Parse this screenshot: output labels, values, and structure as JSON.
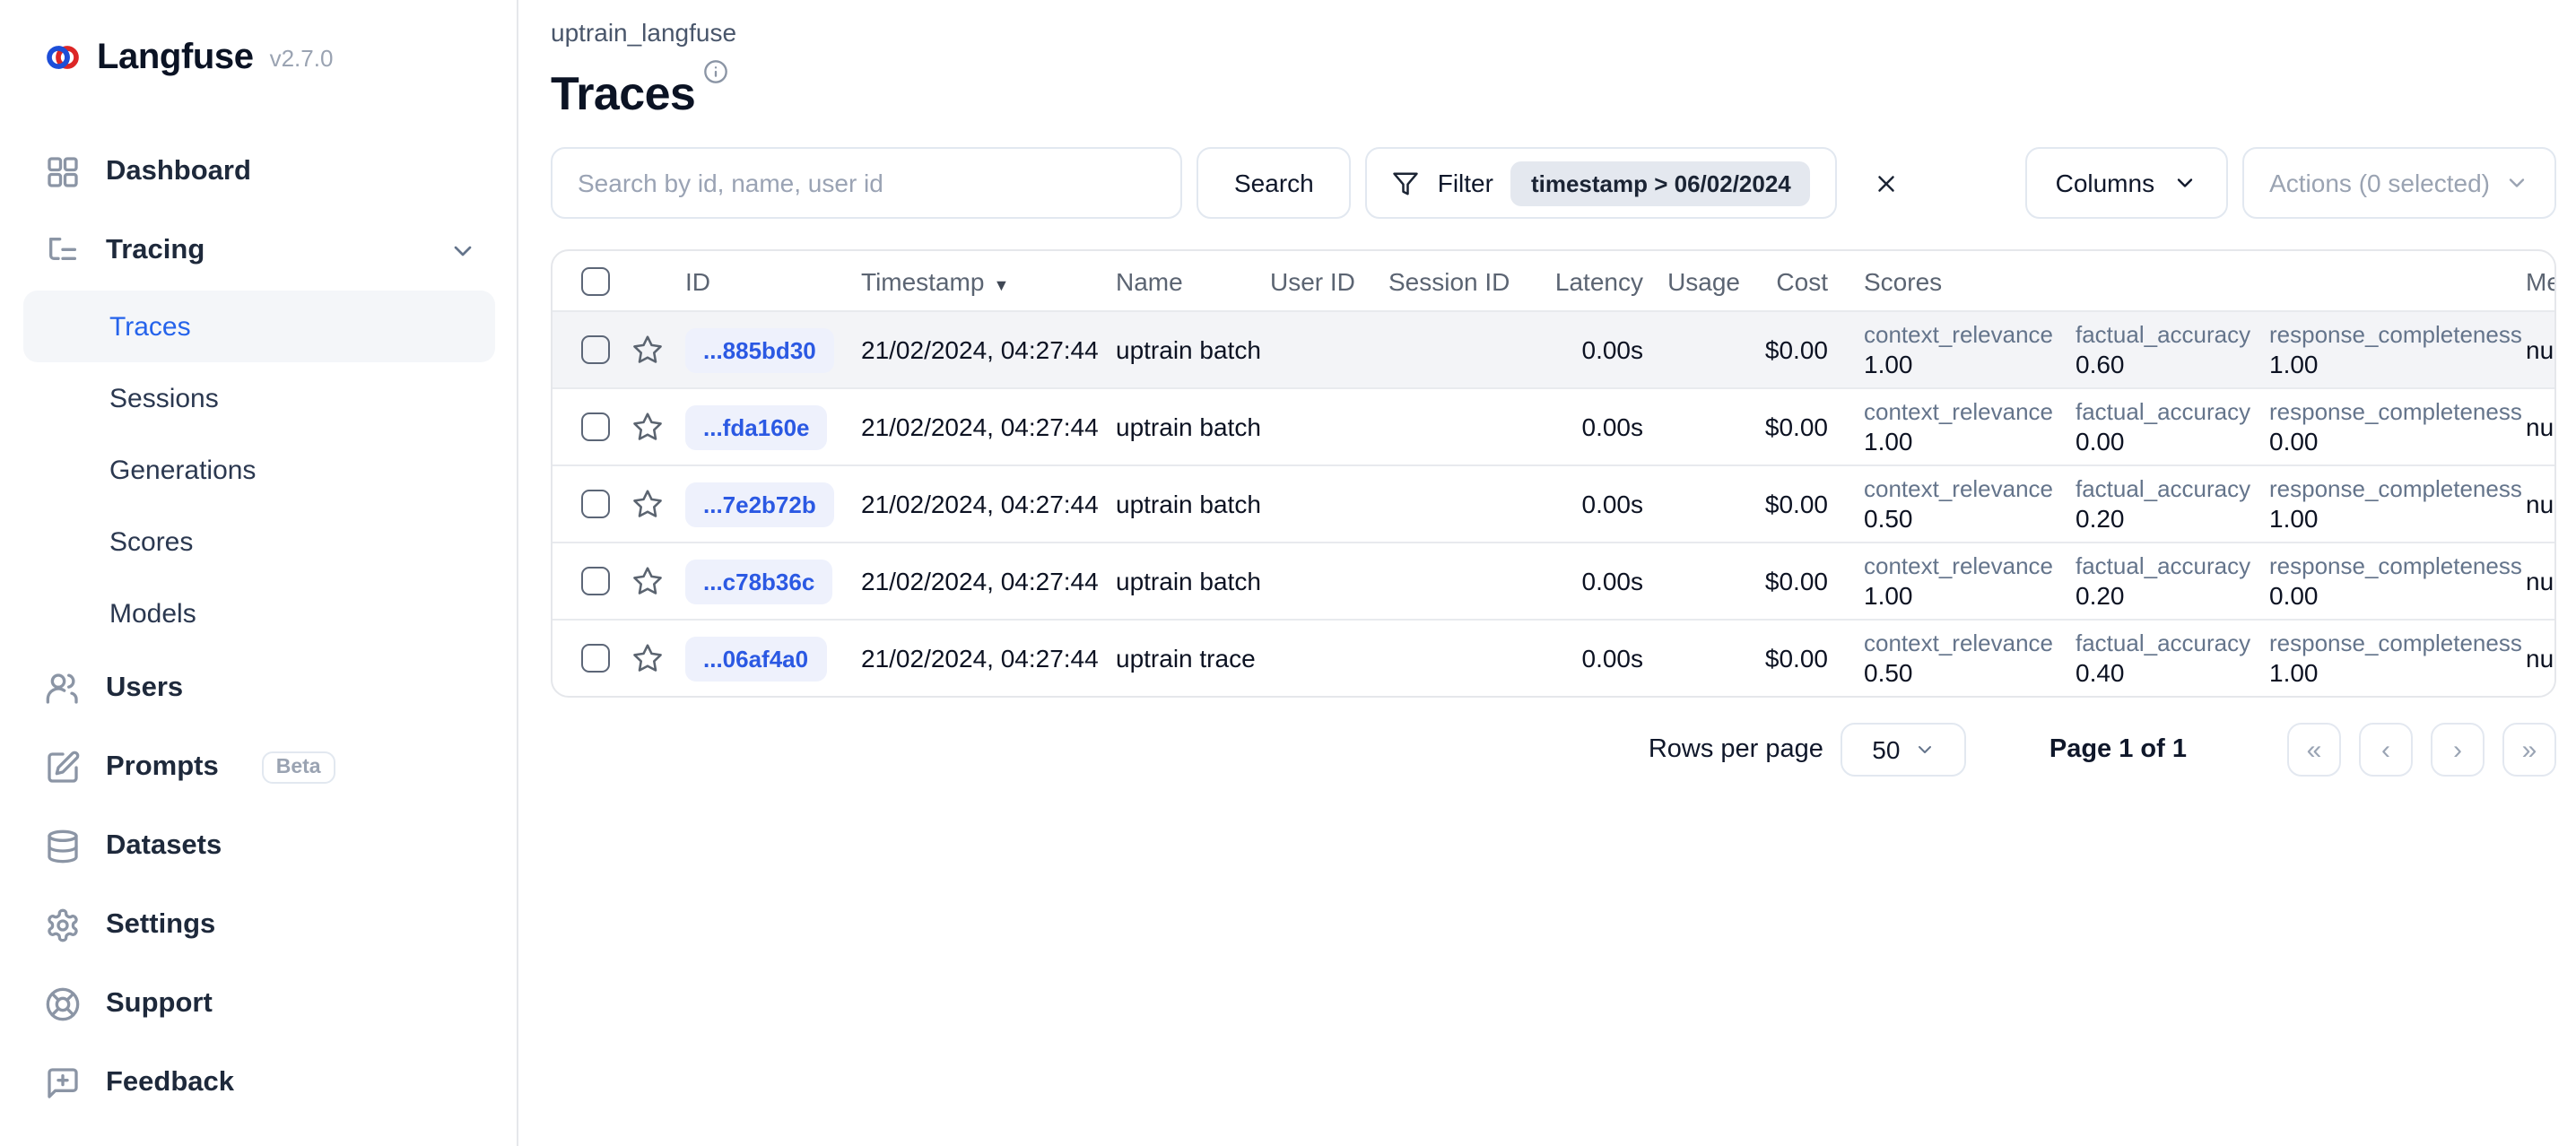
{
  "app": {
    "name": "Langfuse",
    "version": "v2.7.0"
  },
  "sidebar": {
    "items": [
      {
        "label": "Dashboard",
        "icon": "dashboard-grid-icon"
      },
      {
        "label": "Tracing",
        "icon": "list-tree-icon",
        "expanded": true,
        "children": [
          {
            "label": "Traces",
            "active": true
          },
          {
            "label": "Sessions"
          },
          {
            "label": "Generations"
          },
          {
            "label": "Scores"
          },
          {
            "label": "Models"
          }
        ]
      },
      {
        "label": "Users",
        "icon": "users-icon"
      },
      {
        "label": "Prompts",
        "icon": "pen-square-icon",
        "badge": "Beta"
      },
      {
        "label": "Datasets",
        "icon": "database-icon"
      },
      {
        "label": "Settings",
        "icon": "gear-icon"
      },
      {
        "label": "Support",
        "icon": "lifebuoy-icon"
      },
      {
        "label": "Feedback",
        "icon": "message-plus-icon"
      }
    ]
  },
  "header": {
    "breadcrumb": "uptrain_langfuse",
    "title": "Traces"
  },
  "toolbar": {
    "search_placeholder": "Search by id, name, user id",
    "search_button": "Search",
    "filter_button": "Filter",
    "filter_chip": "timestamp > 06/02/2024",
    "columns_button": "Columns",
    "actions_button": "Actions (0 selected)"
  },
  "table": {
    "columns": [
      "ID",
      "Timestamp",
      "Name",
      "User ID",
      "Session ID",
      "Latency",
      "Usage",
      "Cost",
      "Scores",
      "Metadata"
    ],
    "sort_column": "Timestamp",
    "sort_direction": "desc",
    "rows": [
      {
        "id": "...885bd30",
        "timestamp": "21/02/2024, 04:27:44",
        "name": "uptrain batch",
        "user_id": "",
        "session_id": "",
        "latency": "0.00s",
        "usage": "",
        "cost": "$0.00",
        "scores": [
          {
            "label": "context_relevance",
            "value": "1.00"
          },
          {
            "label": "factual_accuracy",
            "value": "0.60"
          },
          {
            "label": "response_completeness",
            "value": "1.00"
          }
        ],
        "metadata": "null"
      },
      {
        "id": "...fda160e",
        "timestamp": "21/02/2024, 04:27:44",
        "name": "uptrain batch",
        "user_id": "",
        "session_id": "",
        "latency": "0.00s",
        "usage": "",
        "cost": "$0.00",
        "scores": [
          {
            "label": "context_relevance",
            "value": "1.00"
          },
          {
            "label": "factual_accuracy",
            "value": "0.00"
          },
          {
            "label": "response_completeness",
            "value": "0.00"
          }
        ],
        "metadata": "null"
      },
      {
        "id": "...7e2b72b",
        "timestamp": "21/02/2024, 04:27:44",
        "name": "uptrain batch",
        "user_id": "",
        "session_id": "",
        "latency": "0.00s",
        "usage": "",
        "cost": "$0.00",
        "scores": [
          {
            "label": "context_relevance",
            "value": "0.50"
          },
          {
            "label": "factual_accuracy",
            "value": "0.20"
          },
          {
            "label": "response_completeness",
            "value": "1.00"
          }
        ],
        "metadata": "null"
      },
      {
        "id": "...c78b36c",
        "timestamp": "21/02/2024, 04:27:44",
        "name": "uptrain batch",
        "user_id": "",
        "session_id": "",
        "latency": "0.00s",
        "usage": "",
        "cost": "$0.00",
        "scores": [
          {
            "label": "context_relevance",
            "value": "1.00"
          },
          {
            "label": "factual_accuracy",
            "value": "0.20"
          },
          {
            "label": "response_completeness",
            "value": "0.00"
          }
        ],
        "metadata": "null"
      },
      {
        "id": "...06af4a0",
        "timestamp": "21/02/2024, 04:27:44",
        "name": "uptrain trace",
        "user_id": "",
        "session_id": "",
        "latency": "0.00s",
        "usage": "",
        "cost": "$0.00",
        "scores": [
          {
            "label": "context_relevance",
            "value": "0.50"
          },
          {
            "label": "factual_accuracy",
            "value": "0.40"
          },
          {
            "label": "response_completeness",
            "value": "1.00"
          }
        ],
        "metadata": "null"
      }
    ]
  },
  "pagination": {
    "rows_per_page_label": "Rows per page",
    "rows_per_page_value": "50",
    "page_info": "Page 1 of 1"
  },
  "colors": {
    "accent_blue": "#2563eb",
    "id_chip_bg": "#eef1fc",
    "id_chip_text": "#2b59e3",
    "row_highlight": "#f3f4f7",
    "filter_chip_bg": "#e4e8ef",
    "border": "#e5e7eb",
    "muted_text": "#64748b"
  }
}
